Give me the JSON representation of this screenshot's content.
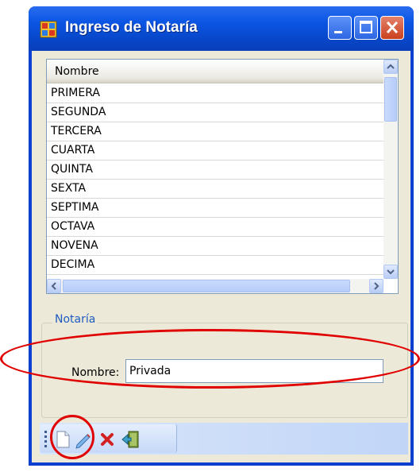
{
  "window": {
    "title": "Ingreso de Notaría"
  },
  "grid": {
    "column_header": "Nombre",
    "rows": [
      "PRIMERA",
      "SEGUNDA",
      "TERCERA",
      "CUARTA",
      "QUINTA",
      "SEXTA",
      "SEPTIMA",
      "OCTAVA",
      "NOVENA",
      "DECIMA"
    ]
  },
  "form": {
    "group_label": "Notaría",
    "nombre_label": "Nombre:",
    "nombre_value": "Privada"
  },
  "toolbar": {
    "icons": [
      "new-icon",
      "edit-icon",
      "delete-icon",
      "exit-icon"
    ]
  },
  "colors": {
    "title_bar": "#0b56e4",
    "annotation": "#e00000",
    "group_label": "#1f5cc0"
  }
}
